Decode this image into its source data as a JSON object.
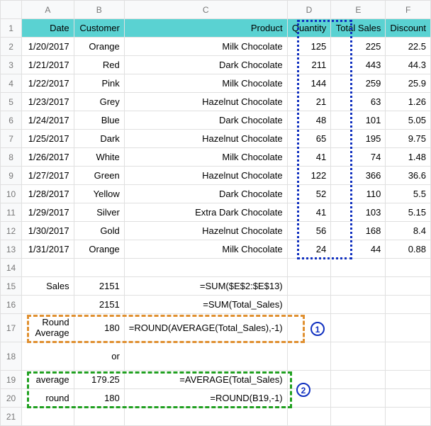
{
  "cols": [
    "A",
    "B",
    "C",
    "D",
    "E",
    "F"
  ],
  "headers": {
    "A": "Date",
    "B": "Customer",
    "C": "Product",
    "D": "Quantity",
    "E": "Total Sales",
    "F": "Discount"
  },
  "rows": [
    {
      "n": 2,
      "A": "1/20/2017",
      "B": "Orange",
      "C": "Milk Chocolate",
      "D": 125,
      "E": 225,
      "F": 22.5
    },
    {
      "n": 3,
      "A": "1/21/2017",
      "B": "Red",
      "C": "Dark Chocolate",
      "D": 211,
      "E": 443,
      "F": 44.3
    },
    {
      "n": 4,
      "A": "1/22/2017",
      "B": "Pink",
      "C": "Milk Chocolate",
      "D": 144,
      "E": 259,
      "F": 25.9
    },
    {
      "n": 5,
      "A": "1/23/2017",
      "B": "Grey",
      "C": "Hazelnut Chocolate",
      "D": 21,
      "E": 63,
      "F": 1.26
    },
    {
      "n": 6,
      "A": "1/24/2017",
      "B": "Blue",
      "C": "Dark Chocolate",
      "D": 48,
      "E": 101,
      "F": 5.05
    },
    {
      "n": 7,
      "A": "1/25/2017",
      "B": "Dark",
      "C": "Hazelnut Chocolate",
      "D": 65,
      "E": 195,
      "F": 9.75
    },
    {
      "n": 8,
      "A": "1/26/2017",
      "B": "White",
      "C": "Milk Chocolate",
      "D": 41,
      "E": 74,
      "F": 1.48
    },
    {
      "n": 9,
      "A": "1/27/2017",
      "B": "Green",
      "C": "Hazelnut Chocolate",
      "D": 122,
      "E": 366,
      "F": 36.6
    },
    {
      "n": 10,
      "A": "1/28/2017",
      "B": "Yellow",
      "C": "Dark Chocolate",
      "D": 52,
      "E": 110,
      "F": 5.5
    },
    {
      "n": 11,
      "A": "1/29/2017",
      "B": "Silver",
      "C": "Extra Dark Chocolate",
      "D": 41,
      "E": 103,
      "F": 5.15
    },
    {
      "n": 12,
      "A": "1/30/2017",
      "B": "Gold",
      "C": "Hazelnut Chocolate",
      "D": 56,
      "E": 168,
      "F": 8.4
    },
    {
      "n": 13,
      "A": "1/31/2017",
      "B": "Orange",
      "C": "Milk Chocolate",
      "D": 24,
      "E": 44,
      "F": 0.88
    }
  ],
  "summary": {
    "r15": {
      "A": "Sales",
      "B": "2151",
      "C": "=SUM($E$2:$E$13)"
    },
    "r16": {
      "B": "2151",
      "C": "=SUM(Total_Sales)"
    },
    "r17": {
      "A": "Round Average",
      "B": "180",
      "C": "=ROUND(AVERAGE(Total_Sales),-1)"
    },
    "r18": {
      "B": "or"
    },
    "r19": {
      "A": "average",
      "B": "179.25",
      "C": "=AVERAGE(Total_Sales)"
    },
    "r20": {
      "A": "round",
      "B": "180",
      "C": "=ROUND(B19,-1)"
    }
  },
  "badges": {
    "b1": "1",
    "b2": "2"
  },
  "chart_data": {
    "type": "table",
    "columns": [
      "Date",
      "Customer",
      "Product",
      "Quantity",
      "Total Sales",
      "Discount"
    ],
    "records": [
      [
        "1/20/2017",
        "Orange",
        "Milk Chocolate",
        125,
        225,
        22.5
      ],
      [
        "1/21/2017",
        "Red",
        "Dark Chocolate",
        211,
        443,
        44.3
      ],
      [
        "1/22/2017",
        "Pink",
        "Milk Chocolate",
        144,
        259,
        25.9
      ],
      [
        "1/23/2017",
        "Grey",
        "Hazelnut Chocolate",
        21,
        63,
        1.26
      ],
      [
        "1/24/2017",
        "Blue",
        "Dark Chocolate",
        48,
        101,
        5.05
      ],
      [
        "1/25/2017",
        "Dark",
        "Hazelnut Chocolate",
        65,
        195,
        9.75
      ],
      [
        "1/26/2017",
        "White",
        "Milk Chocolate",
        41,
        74,
        1.48
      ],
      [
        "1/27/2017",
        "Green",
        "Hazelnut Chocolate",
        122,
        366,
        36.6
      ],
      [
        "1/28/2017",
        "Yellow",
        "Dark Chocolate",
        52,
        110,
        5.5
      ],
      [
        "1/29/2017",
        "Silver",
        "Extra Dark Chocolate",
        41,
        103,
        5.15
      ],
      [
        "1/30/2017",
        "Gold",
        "Hazelnut Chocolate",
        56,
        168,
        8.4
      ],
      [
        "1/31/2017",
        "Orange",
        "Milk Chocolate",
        24,
        44,
        0.88
      ]
    ],
    "aggregates": {
      "Sales_SUM": 2151,
      "Round_Average": 180,
      "Average": 179.25
    },
    "formulas": [
      "=SUM($E$2:$E$13)",
      "=SUM(Total_Sales)",
      "=ROUND(AVERAGE(Total_Sales),-1)",
      "=AVERAGE(Total_Sales)",
      "=ROUND(B19,-1)"
    ]
  }
}
